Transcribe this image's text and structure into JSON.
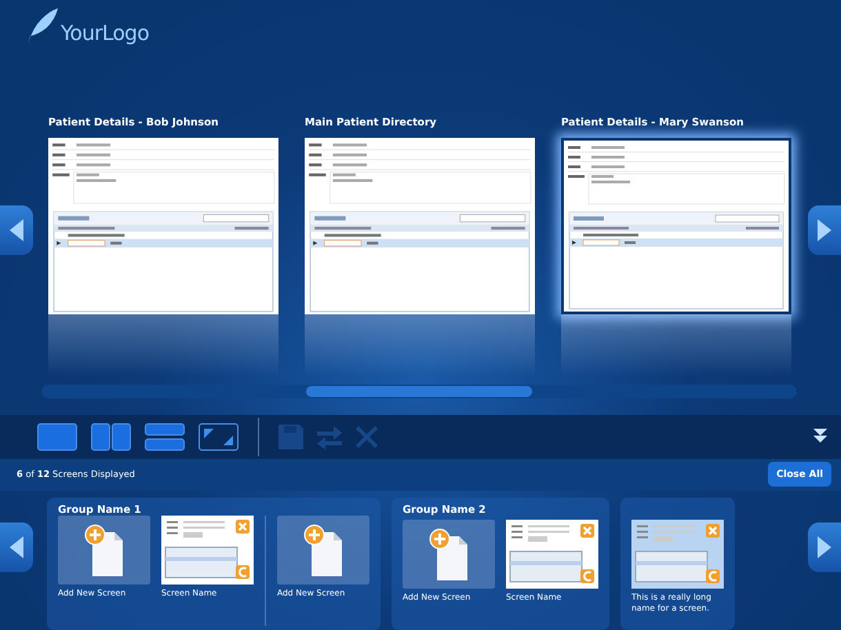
{
  "logo": {
    "text": "YourLogo"
  },
  "screens": [
    {
      "title": "Patient Details - Bob Johnson",
      "selected": false
    },
    {
      "title": "Main Patient Directory",
      "selected": false
    },
    {
      "title": "Patient Details - Mary Swanson",
      "selected": true
    }
  ],
  "toolbar": [
    {
      "kind": "single",
      "disabled": false
    },
    {
      "kind": "columns",
      "disabled": false
    },
    {
      "kind": "rows",
      "disabled": false
    },
    {
      "kind": "resize",
      "disabled": false
    },
    {
      "kind": "save",
      "disabled": true
    },
    {
      "kind": "swap",
      "disabled": true
    },
    {
      "kind": "close",
      "disabled": true
    }
  ],
  "status": "**6** of **12** Screens Displayed",
  "close_all": "Close All",
  "groups": [
    {
      "name": "Group Name 1",
      "items": [
        {
          "kind": "add",
          "label": "Add New Screen"
        },
        {
          "kind": "screen",
          "label": "Screen Name",
          "selected": false
        },
        {
          "kind": "divider"
        },
        {
          "kind": "add",
          "label": "Add New Screen"
        }
      ]
    },
    {
      "name": "Group Name 2",
      "items": [
        {
          "kind": "add",
          "label": "Add New Screen"
        },
        {
          "kind": "screen",
          "label": "Screen Name",
          "selected": false
        }
      ]
    },
    {
      "items": [
        {
          "kind": "screen",
          "label": "This is a really long name for a screen.",
          "selected": true
        }
      ]
    }
  ]
}
